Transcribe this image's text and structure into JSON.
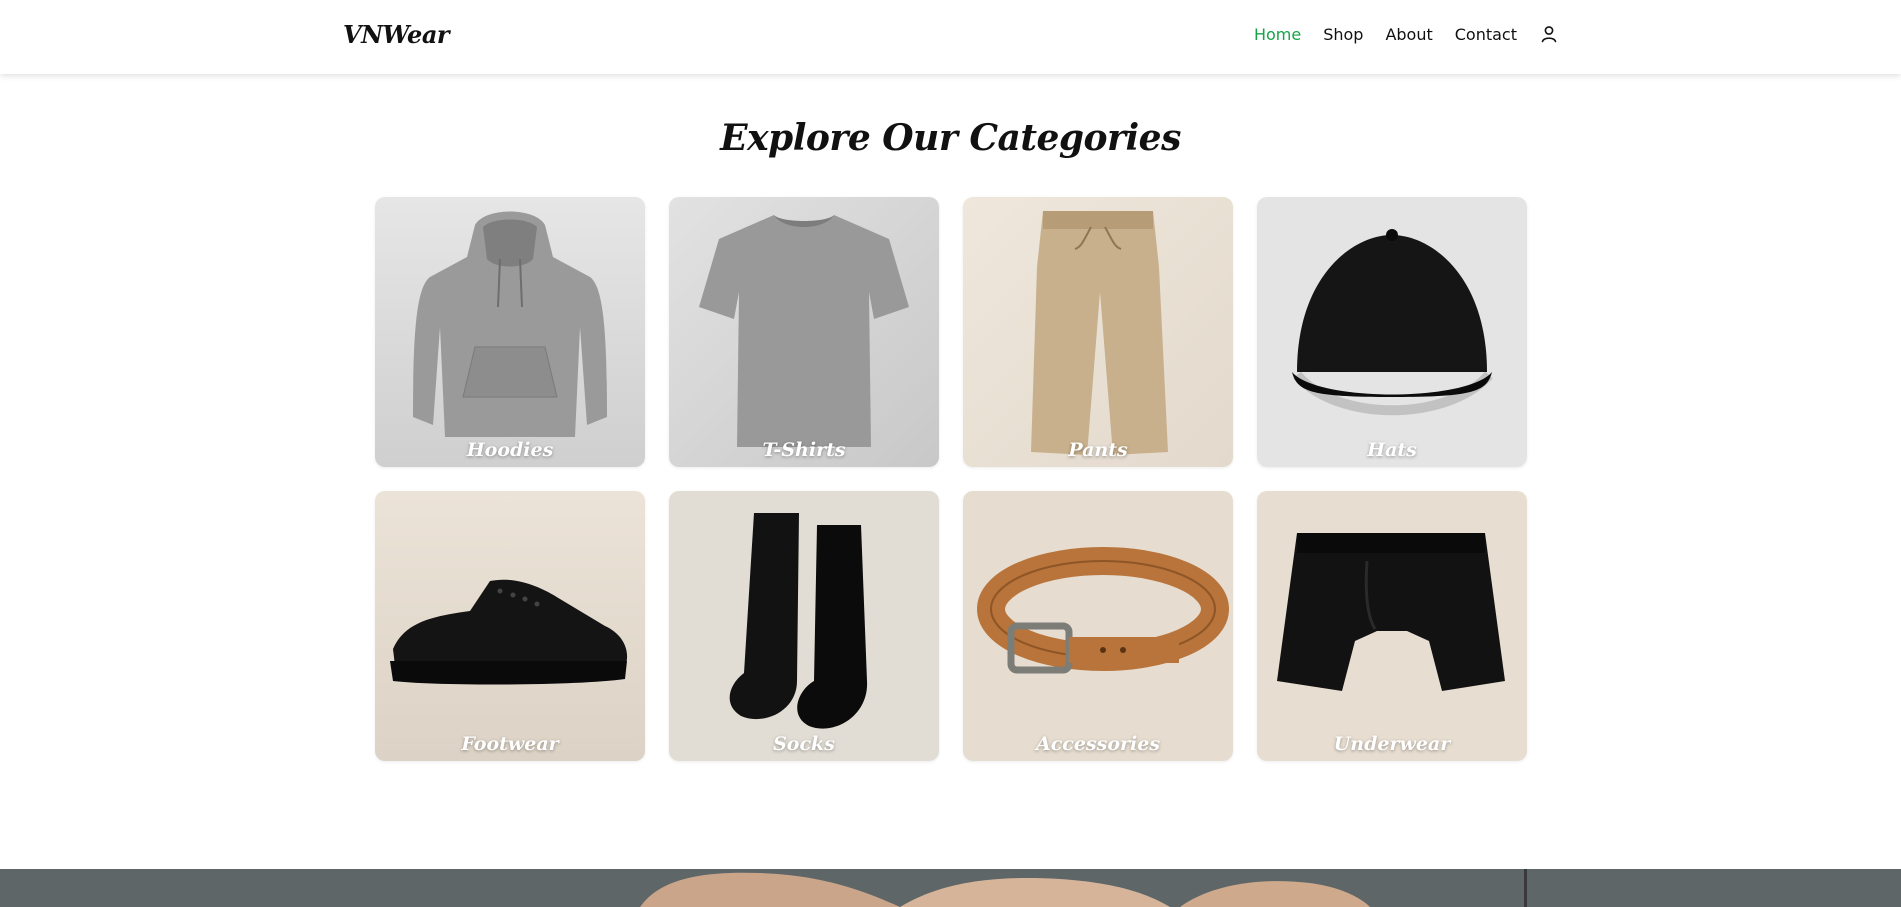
{
  "header": {
    "logo": "VNWear",
    "nav": [
      {
        "label": "Home",
        "active": true
      },
      {
        "label": "Shop",
        "active": false
      },
      {
        "label": "About",
        "active": false
      },
      {
        "label": "Contact",
        "active": false
      }
    ],
    "accent_color": "#16a34a",
    "user_icon": "user-icon"
  },
  "main": {
    "title": "Explore Our Categories",
    "categories": [
      {
        "label": "Hoodies",
        "icon": "hoodie-image"
      },
      {
        "label": "T-Shirts",
        "icon": "tshirt-image"
      },
      {
        "label": "Pants",
        "icon": "pants-image"
      },
      {
        "label": "Hats",
        "icon": "cap-image"
      },
      {
        "label": "Footwear",
        "icon": "sneaker-image"
      },
      {
        "label": "Socks",
        "icon": "socks-image"
      },
      {
        "label": "Accessories",
        "icon": "belt-image"
      },
      {
        "label": "Underwear",
        "icon": "boxer-briefs-image"
      }
    ]
  }
}
